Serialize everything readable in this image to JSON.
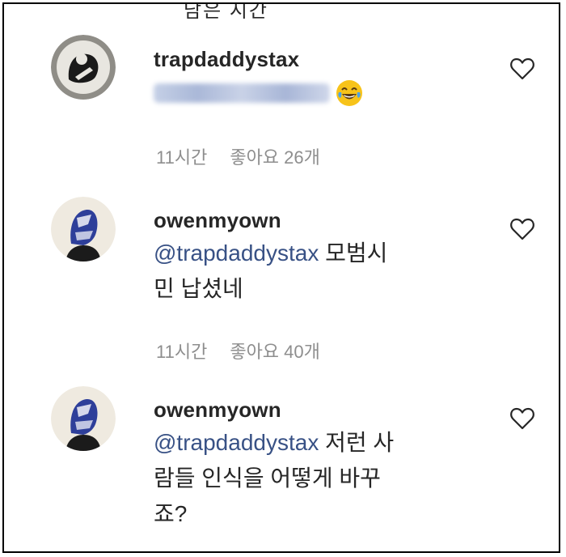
{
  "cutoff_text": "남은 시간",
  "comments": [
    {
      "username": "trapdaddystax",
      "blurred_mention": "@sent_moeng",
      "time": "11시간",
      "likes": "좋아요 26개"
    },
    {
      "username": "owenmyown",
      "mention": "@trapdaddystax",
      "text_line1_rest": " 모범시",
      "text_line2": "민 납셨네",
      "time": "11시간",
      "likes": "좋아요 40개"
    },
    {
      "username": "owenmyown",
      "mention": "@trapdaddystax",
      "text_line1_rest": " 저런 사",
      "text_line2": "람들 인식을 어떻게 바꾸",
      "text_line3": "죠?"
    }
  ]
}
